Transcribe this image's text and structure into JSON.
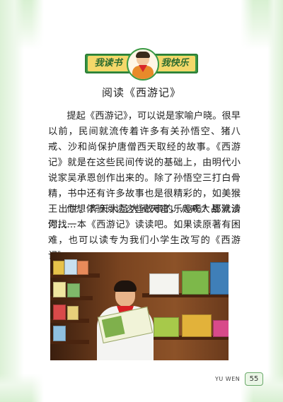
{
  "banner": {
    "left_text": "我读书",
    "right_text": "我快乐"
  },
  "article": {
    "title": "阅读《西游记》",
    "paragraph1": "提起《西游记》，可以说是家喻户晓。很早以前，民间就流传着许多有关孙悟空、猪八戒、沙和尚保护唐僧西天取经的故事。《西游记》就是在这些民间传说的基础上，由明代小说家吴承恩创作出来的。除了孙悟空三打白骨精，书中还有许多故事也是很精彩的，如美猴王出世，齐天大圣大闹天宫，八戒大战流沙河……",
    "paragraph2": "你想体验阅读这些故事的乐趣吗？那就请你找一本《西游记》读读吧。如果读原著有困难，也可以读专为我们小学生改写的《西游记》。"
  },
  "photo": {
    "subject": "child-reading-book-photo"
  },
  "footer": {
    "label": "YU WEN",
    "page_number": "55"
  },
  "colors": {
    "frame_green": "#dcf1d6",
    "banner_green": "#3b9a45",
    "banner_yellow": "#f4d86a"
  }
}
